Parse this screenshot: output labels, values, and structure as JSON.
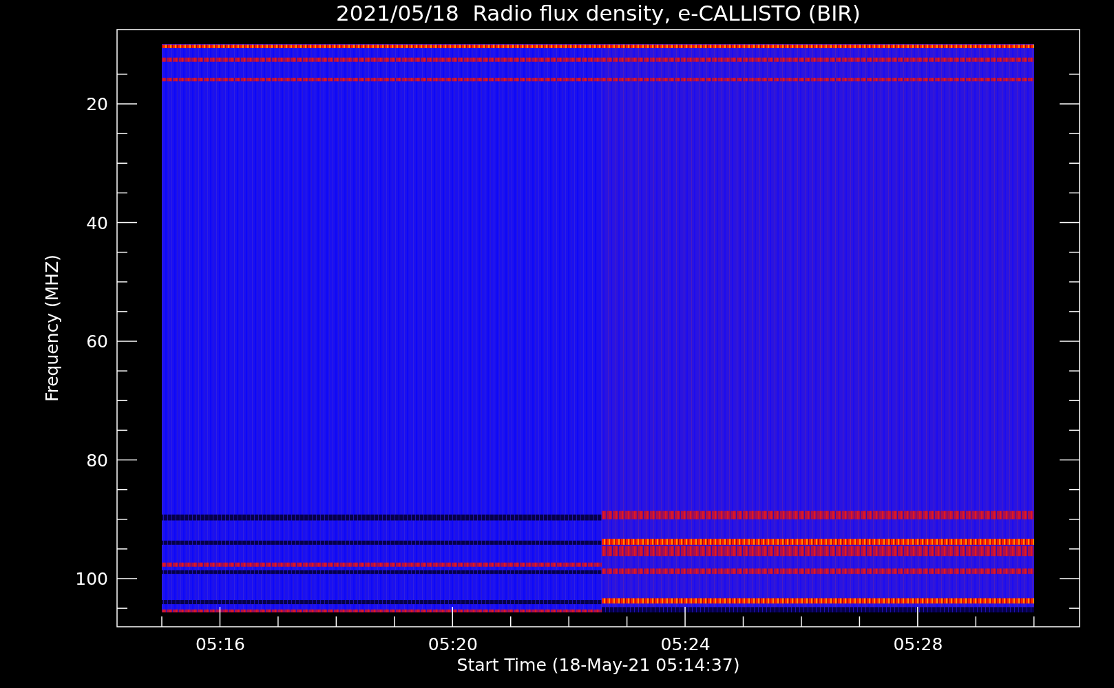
{
  "chart": {
    "title": "2021/05/18  Radio flux density, e-CALLISTO (BIR)",
    "ylabel": "Frequency (MHZ)",
    "xlabel": "Start Time (18-May-21 05:14:37)",
    "yticks": [
      "20",
      "40",
      "60",
      "80",
      "100"
    ],
    "xticks": [
      "05:16",
      "05:20",
      "05:24",
      "05:28"
    ]
  }
}
